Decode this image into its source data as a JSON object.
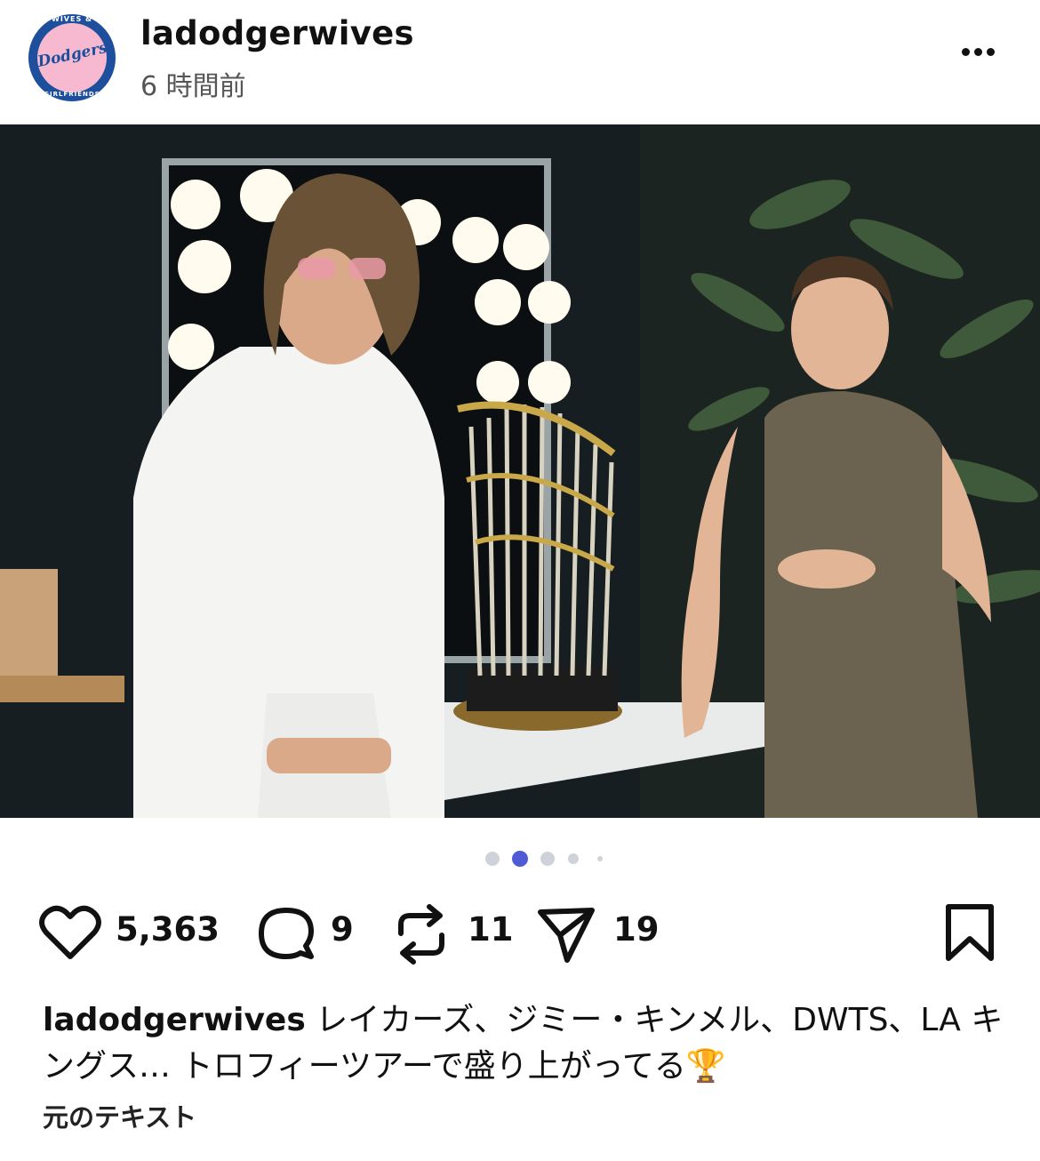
{
  "post": {
    "username": "ladodgerwives",
    "timestamp": "6 時間前",
    "avatar": {
      "top_text": "WIVES &",
      "script_text": "Dodgers",
      "bottom_text": "GIRLFRIENDS"
    },
    "more_icon": "more-horizontal-icon",
    "carousel": {
      "count": 5,
      "active_index": 1
    },
    "stats": {
      "likes": "5,363",
      "comments": "9",
      "reposts": "11",
      "shares": "19"
    },
    "caption": {
      "username": "ladodgerwives",
      "text": "レイカーズ、ジミー・キンメル、DWTS、LA キングス… トロフィーツアーで盛り上がってる🏆"
    },
    "translate_label": "元のテキスト"
  },
  "colors": {
    "accent": "#4f5bd5",
    "dot_inactive": "#cfd2d8",
    "avatar_blue": "#1d4f9c",
    "avatar_pink": "#f6b9cf"
  }
}
